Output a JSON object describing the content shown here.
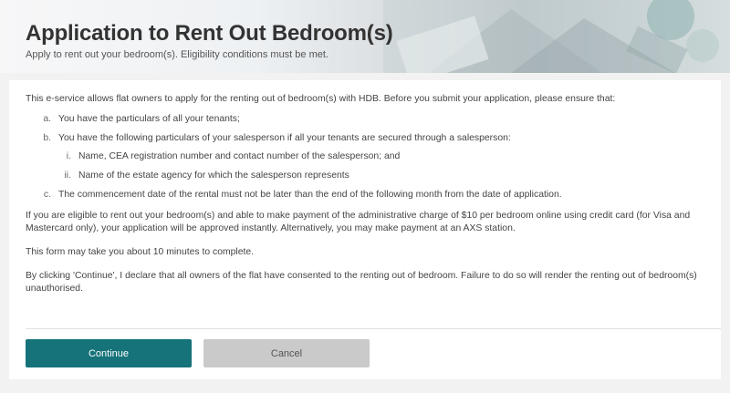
{
  "header": {
    "title": "Application to Rent Out Bedroom(s)",
    "subtitle": "Apply to rent out your bedroom(s). Eligibility conditions must be met."
  },
  "content": {
    "intro": "This e-service allows flat owners to apply for the renting out of bedroom(s) with HDB. Before you submit your application, please ensure that:",
    "items": [
      {
        "marker": "a.",
        "text": "You have the particulars of all your tenants;"
      },
      {
        "marker": "b.",
        "text": "You have the following particulars of your salesperson if all your tenants are secured through a salesperson:",
        "subitems": [
          {
            "marker": "i.",
            "text": "Name, CEA registration number and contact number of the salesperson; and"
          },
          {
            "marker": "ii.",
            "text": "Name of the estate agency for which the salesperson represents"
          }
        ]
      },
      {
        "marker": "c.",
        "text": "The commencement date of the rental must not be later than the end of the following month from the date of application."
      }
    ],
    "payment_note": "If you are eligible to rent out your bedroom(s) and able to make payment of the administrative charge of $10 per bedroom online using credit card (for Visa and Mastercard only), your application will be approved instantly. Alternatively, you may make payment at an AXS station.",
    "time_note": "This form may take you about 10 minutes to complete.",
    "declaration": "By clicking 'Continue', I declare that all owners of the flat have consented to the renting out of bedroom. Failure to do so will render the renting out of bedroom(s) unauthorised."
  },
  "buttons": {
    "continue_label": "Continue",
    "cancel_label": "Cancel"
  },
  "colors": {
    "primary": "#16737a",
    "secondary": "#cacaca"
  }
}
